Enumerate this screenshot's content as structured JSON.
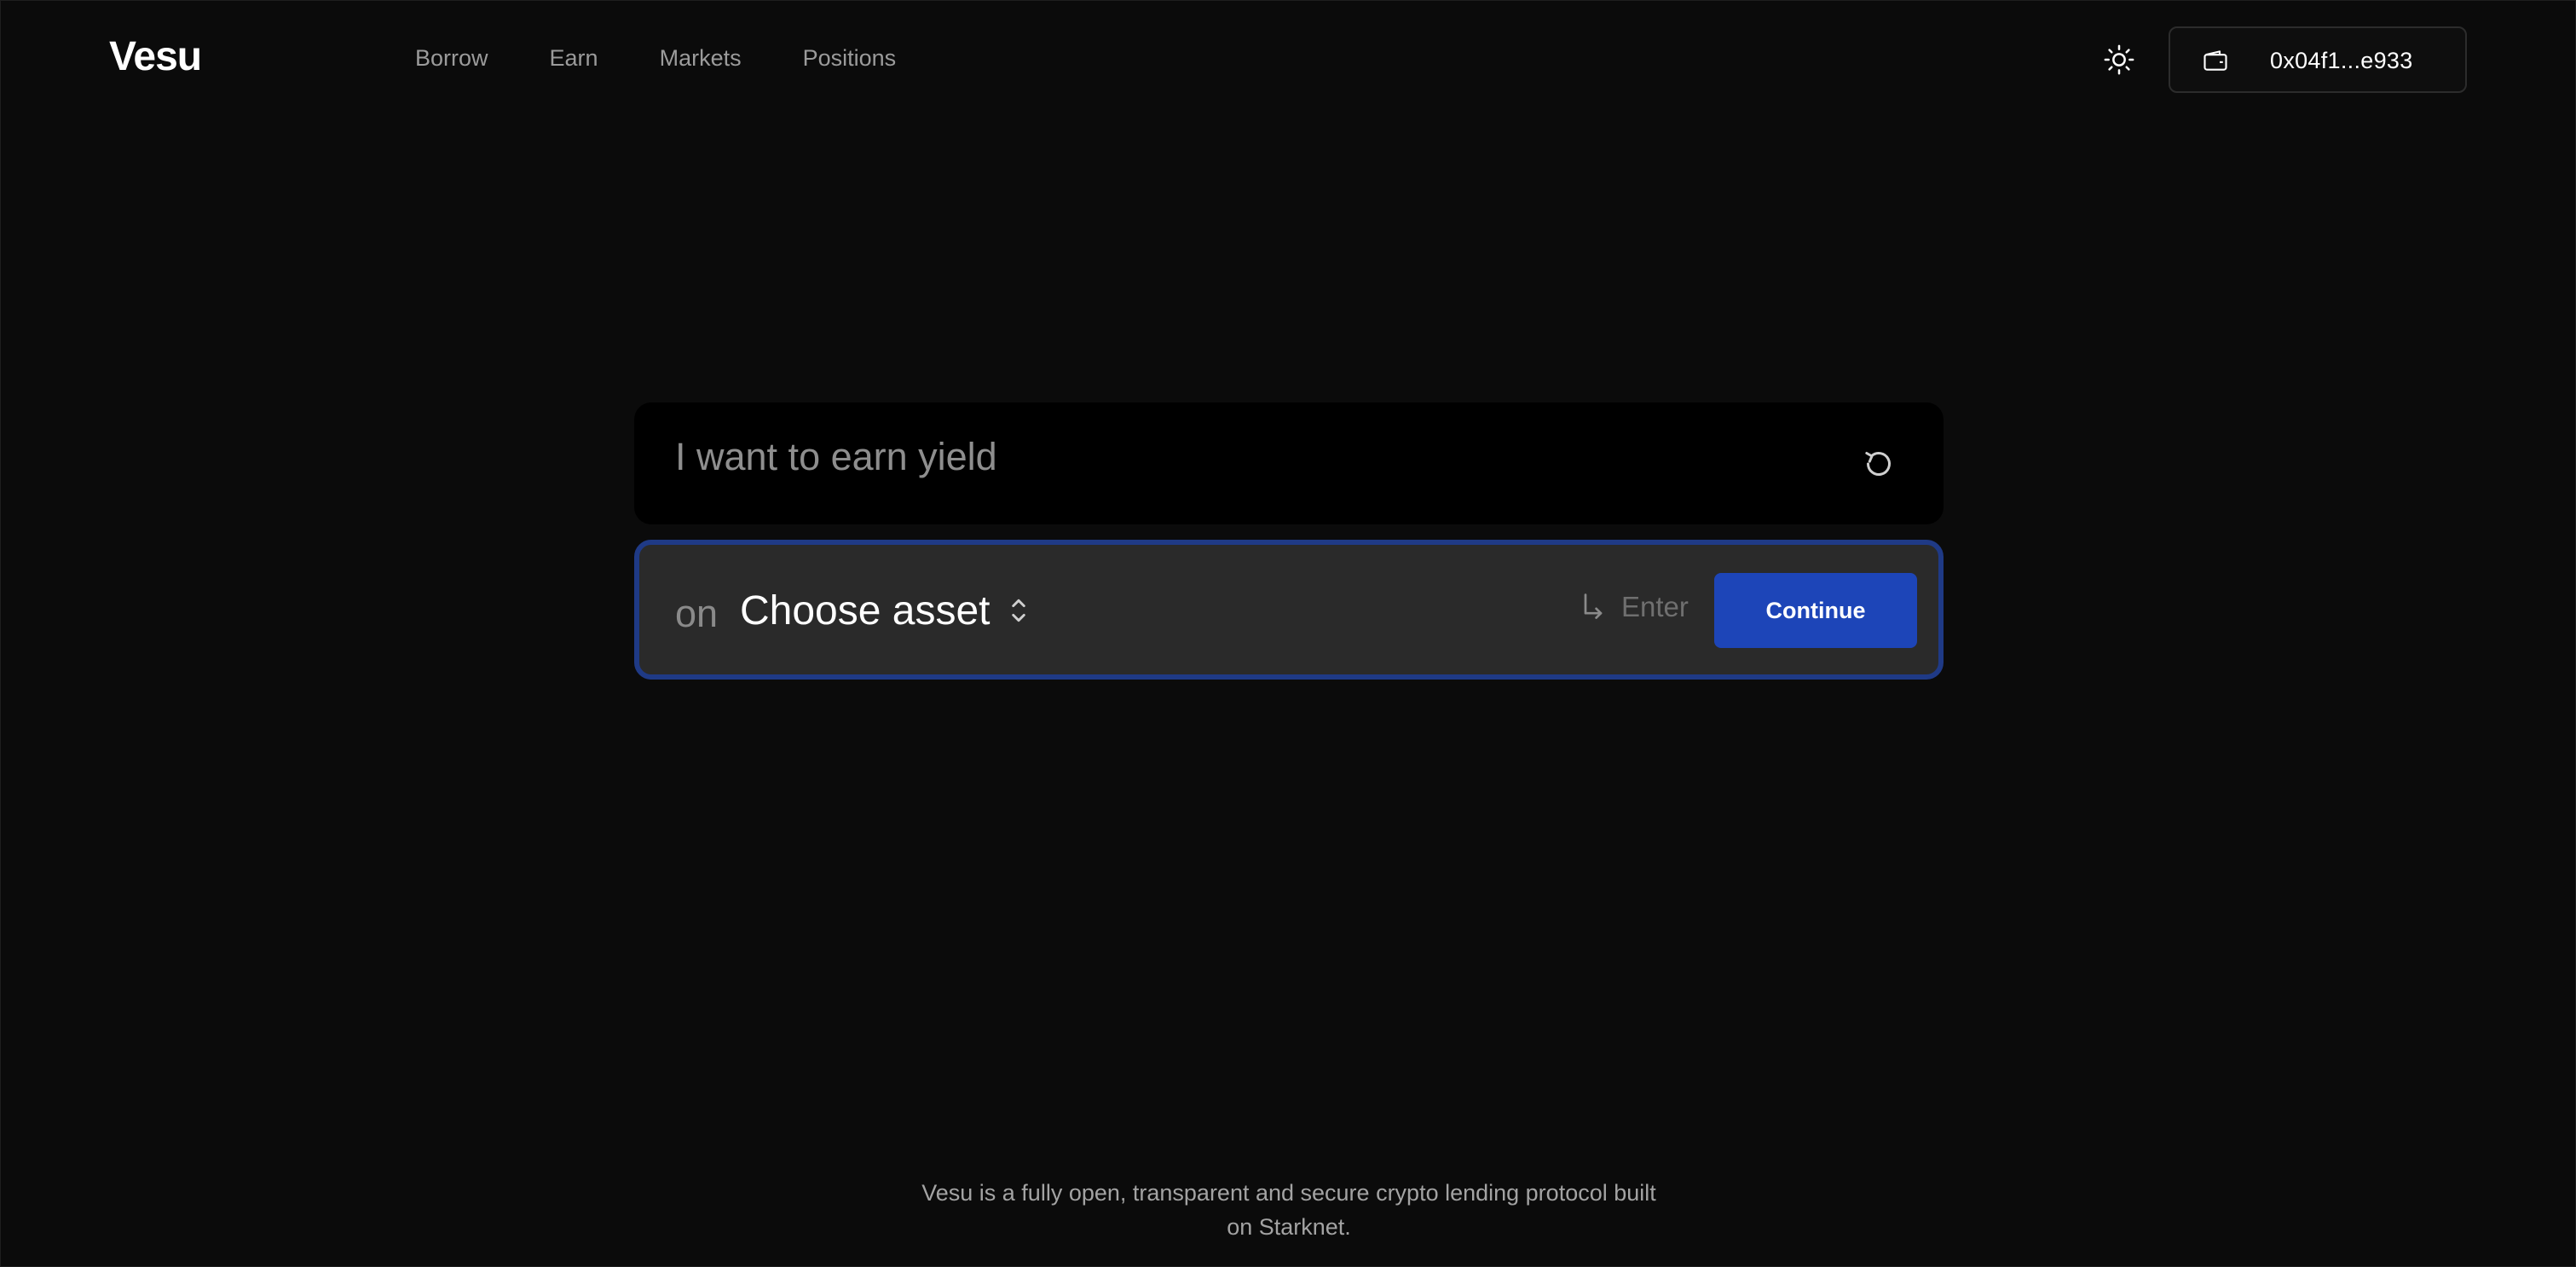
{
  "brand": {
    "name": "Vesu"
  },
  "nav": {
    "items": [
      {
        "label": "Borrow"
      },
      {
        "label": "Earn"
      },
      {
        "label": "Markets"
      },
      {
        "label": "Positions"
      }
    ]
  },
  "header": {
    "theme_icon": "sun-icon",
    "wallet": {
      "icon": "wallet-icon",
      "address": "0x04f1...e933"
    }
  },
  "intent": {
    "text": "I want to earn yield",
    "reset_icon": "reset-icon"
  },
  "asset_row": {
    "prefix": "on",
    "select_label": "Choose asset",
    "select_icon": "chevron-up-down-icon",
    "enter_icon": "enter-arrow-icon",
    "enter_hint": "Enter",
    "continue_label": "Continue"
  },
  "footer": {
    "line1": "Vesu is a fully open, transparent and secure crypto lending protocol built",
    "line2": "on Starknet."
  },
  "colors": {
    "background": "#0b0b0b",
    "accent": "#1d45b8",
    "focus_border": "#1f3a86",
    "muted_text": "#9b9b9b"
  }
}
